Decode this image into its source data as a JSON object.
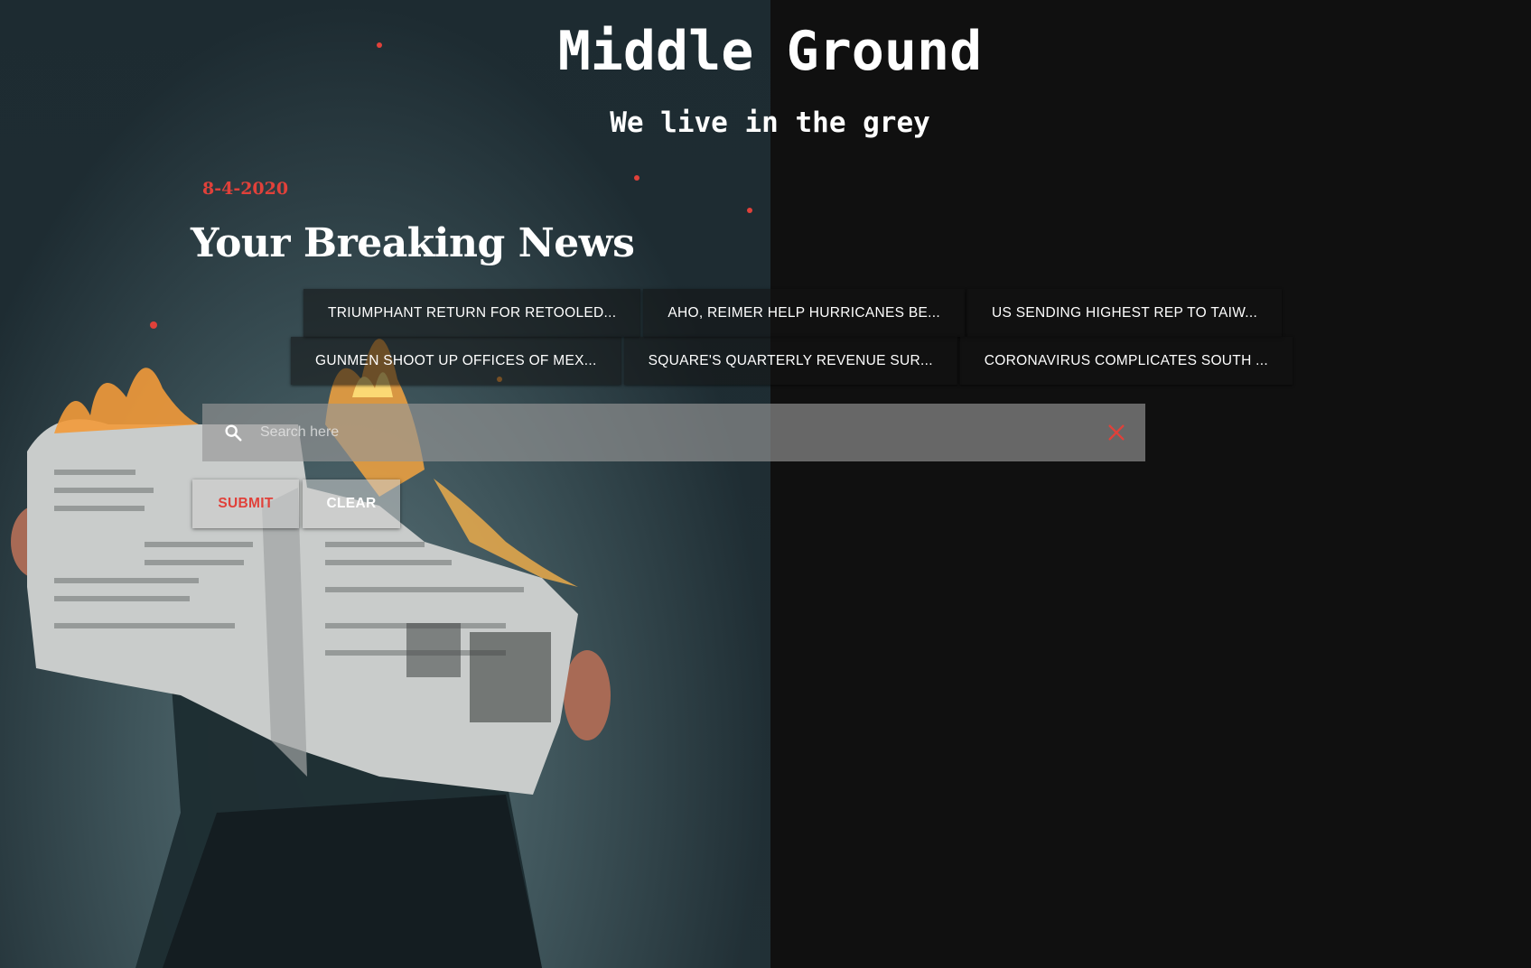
{
  "header": {
    "title": "Middle Ground",
    "tagline": "We live in the grey"
  },
  "main": {
    "date": "8-4-2020",
    "heading": "Your Breaking News",
    "news_row_1": [
      "TRIUMPHANT RETURN FOR RETOOLED...",
      "AHO, REIMER HELP HURRICANES BE...",
      "US SENDING HIGHEST REP TO TAIW..."
    ],
    "news_row_2": [
      "GUNMEN SHOOT UP OFFICES OF MEX...",
      "SQUARE'S QUARTERLY REVENUE SUR...",
      "CORONAVIRUS COMPLICATES SOUTH ..."
    ]
  },
  "search": {
    "placeholder": "Search here",
    "value": "",
    "search_icon": "search-icon",
    "clear_icon": "close-icon"
  },
  "buttons": {
    "submit_label": "SUBMIT",
    "clear_label": "CLEAR"
  },
  "colors": {
    "background": "#101010",
    "accent_red": "#e0413a",
    "text": "#ffffff"
  }
}
